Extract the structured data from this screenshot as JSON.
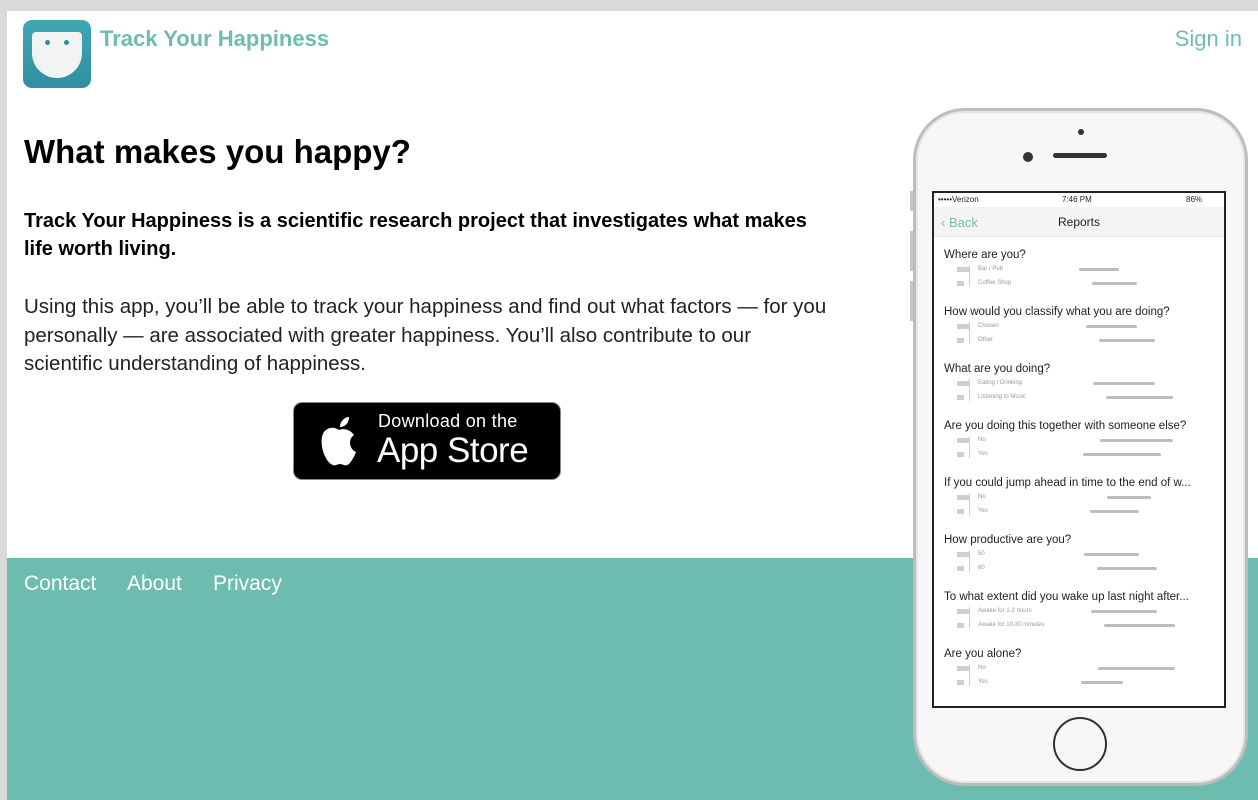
{
  "header": {
    "brand": "Track Your Happiness",
    "signin": "Sign in"
  },
  "hero": {
    "title": "What makes you happy?",
    "lead": "Track Your Happiness is a scientific research project that investigates what makes life worth living.",
    "body": "Using this app, you’ll be able to track your happiness and find out what factors — for you personally — are associated with greater happiness. You’ll also contribute to our scientific understanding of happiness."
  },
  "appstore": {
    "small": "Download on the",
    "big": "App Store"
  },
  "footer": {
    "links": [
      "Contact",
      "About",
      "Privacy"
    ]
  },
  "phone": {
    "status": {
      "carrier": "•••••Verizon",
      "time": "7:46 PM",
      "battery": "86%"
    },
    "nav": {
      "back": "Back",
      "title": "Reports"
    },
    "questions": [
      {
        "text": "Where are you?",
        "rows": [
          "Bar / Pub",
          "Coffee Shop"
        ]
      },
      {
        "text": "How would you classify what you are doing?",
        "rows": [
          "Chosen",
          "Other"
        ]
      },
      {
        "text": "What are you doing?",
        "rows": [
          "Eating / Drinking",
          "Listening to Music"
        ]
      },
      {
        "text": "Are you doing this together with someone else?",
        "rows": [
          "No",
          "Yes"
        ]
      },
      {
        "text": "If you could jump ahead in time to the end of w...",
        "rows": [
          "No",
          "Yes"
        ]
      },
      {
        "text": "How productive are you?",
        "rows": [
          "50",
          "60"
        ]
      },
      {
        "text": "To what extent did you wake up last night after...",
        "rows": [
          "Awake for 1-2 hours",
          "Awake for 10-30 minutes"
        ]
      },
      {
        "text": "Are you alone?",
        "rows": [
          "No",
          "Yes"
        ]
      }
    ]
  },
  "colors": {
    "accent": "#6cbdb0",
    "logo": "#2f8fa1"
  }
}
